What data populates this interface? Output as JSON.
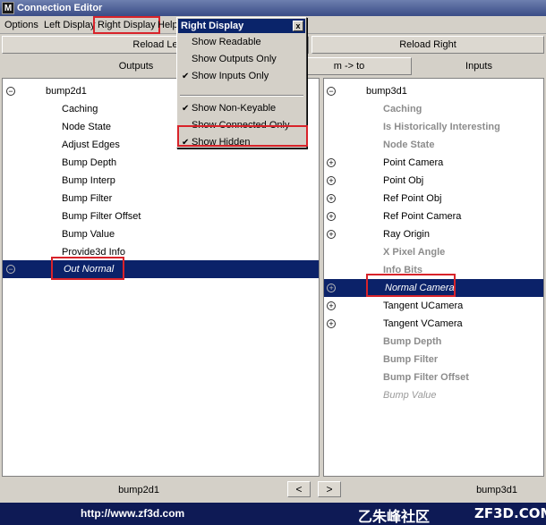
{
  "window": {
    "title": "Connection Editor",
    "app_icon_glyph": "M"
  },
  "menubar": {
    "items": [
      "Options",
      "Left Display",
      "Right Display",
      "Help"
    ]
  },
  "reload": {
    "left_label": "Reload Le",
    "right_label": "Reload Right"
  },
  "headers": {
    "left": "Outputs",
    "arrow_button": "m -> to",
    "right": "Inputs"
  },
  "left_panel": {
    "root": "bump2d1",
    "items": [
      "Caching",
      "Node State",
      "Adjust Edges",
      "Bump Depth",
      "Bump Interp",
      "Bump Filter",
      "Bump Filter Offset",
      "Bump Value",
      "Provide3d Info"
    ],
    "selected": "Out Normal"
  },
  "right_panel": {
    "root": "bump3d1",
    "items": [
      {
        "label": "Caching",
        "style": "grey"
      },
      {
        "label": "Is Historically Interesting",
        "style": "grey"
      },
      {
        "label": "Node State",
        "style": "grey"
      },
      {
        "label": "Point Camera",
        "style": "normal"
      },
      {
        "label": "Point Obj",
        "style": "normal"
      },
      {
        "label": "Ref Point Obj",
        "style": "normal"
      },
      {
        "label": "Ref Point Camera",
        "style": "normal"
      },
      {
        "label": "Ray Origin",
        "style": "normal"
      },
      {
        "label": "X Pixel Angle",
        "style": "grey"
      },
      {
        "label": "Info Bits",
        "style": "grey"
      },
      {
        "label": "Normal Camera",
        "style": "selected"
      },
      {
        "label": "Tangent UCamera",
        "style": "normal"
      },
      {
        "label": "Tangent VCamera",
        "style": "normal"
      },
      {
        "label": "Bump Depth",
        "style": "grey"
      },
      {
        "label": "Bump Filter",
        "style": "grey"
      },
      {
        "label": "Bump Filter Offset",
        "style": "grey"
      },
      {
        "label": "Bump Value",
        "style": "greyital"
      }
    ]
  },
  "bottom": {
    "left_label": "bump2d1",
    "right_label": "bump3d1",
    "prev_glyph": "<",
    "next_glyph": ">"
  },
  "dropdown": {
    "title": "Right Display",
    "close_glyph": "x",
    "items": [
      {
        "label": "Show Readable",
        "checked": false
      },
      {
        "label": "Show Outputs Only",
        "checked": false
      },
      {
        "label": "Show Inputs Only",
        "checked": true
      },
      {
        "label": "Show Non-Keyable",
        "checked": true
      },
      {
        "label": "Show Connected Only",
        "checked": false
      },
      {
        "label": "Show Hidden",
        "checked": true
      }
    ],
    "check_glyph": "✔"
  },
  "footer": {
    "url": "http://www.zf3d.com",
    "brand": "乙朱峰社区",
    "site": "ZF3D.COM"
  },
  "colors": {
    "selection": "#0b2269",
    "highlight_box": "#d8232a",
    "footer": "#0e1a55"
  }
}
